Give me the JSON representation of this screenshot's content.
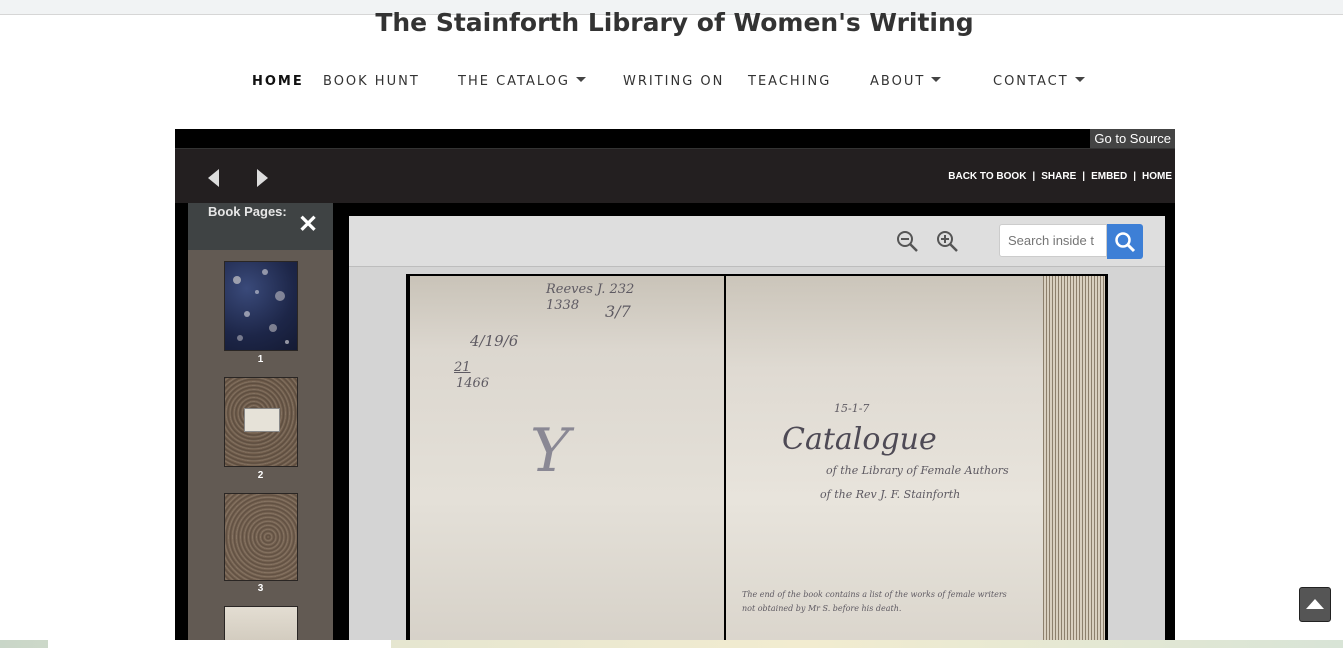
{
  "site": {
    "title": "The Stainforth Library of Women's Writing"
  },
  "nav": {
    "items": [
      {
        "label": "HOME",
        "active": true,
        "dropdown": false
      },
      {
        "label": "BOOK HUNT",
        "active": false,
        "dropdown": false
      },
      {
        "label": "THE CATALOG",
        "active": false,
        "dropdown": true
      },
      {
        "label": "WRITING ON",
        "active": false,
        "dropdown": false
      },
      {
        "label": "TEACHING",
        "active": false,
        "dropdown": false
      },
      {
        "label": "ABOUT",
        "active": false,
        "dropdown": true
      },
      {
        "label": "CONTACT",
        "active": false,
        "dropdown": true
      }
    ]
  },
  "viewer": {
    "go_to_source": "Go to Source",
    "top_links": [
      "BACK TO BOOK",
      "SHARE",
      "EMBED",
      "HOME"
    ],
    "separator": "|",
    "pages_panel": {
      "title": "Book Pages:",
      "close": "✕",
      "thumbnails": [
        {
          "label": "1"
        },
        {
          "label": "2"
        },
        {
          "label": "3"
        }
      ]
    },
    "search": {
      "placeholder": "Search inside t"
    },
    "icons": {
      "zoom_out": "zoom-out-icon",
      "zoom_in": "zoom-in-icon",
      "search": "search-icon",
      "prev": "prev-arrow-icon",
      "next": "next-arrow-icon"
    },
    "book": {
      "left_page_marks": [
        "Reeves J. 232",
        "1338",
        "3/7",
        "4/19/6",
        "21",
        "1466",
        "Y"
      ],
      "right_page_marks": [
        "15-1-7",
        "Catalogue",
        "of the Library of Female Authors",
        "of the Rev J. F. Stainforth",
        "The end of the book contains a list of the works of female writers",
        "not obtained by Mr S. before his death."
      ]
    }
  },
  "colors": {
    "accent_blue": "#3d7fd6",
    "viewer_dark": "#231f20",
    "pages_panel": "#625a53"
  }
}
